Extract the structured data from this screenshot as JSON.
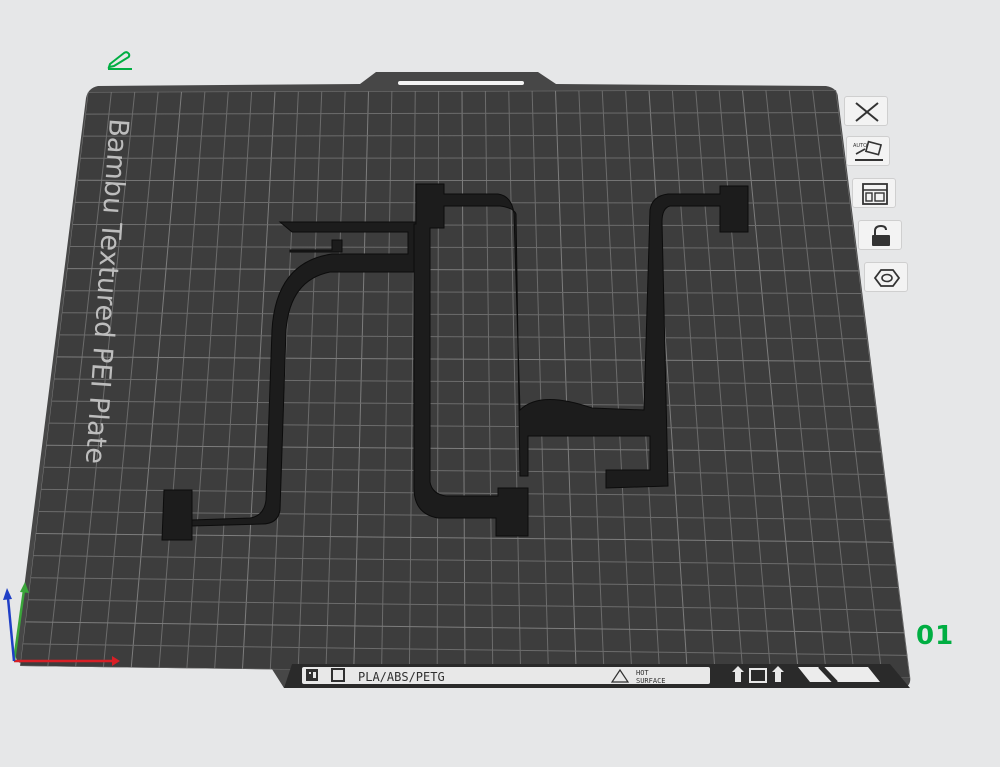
{
  "plate": {
    "name": "Bambu Textured PEI Plate",
    "material_label": "PLA/ABS/PETG",
    "hot_label_line1": "HOT",
    "hot_label_line2": "SURFACE",
    "number": "01"
  },
  "toolbar": {
    "icons": [
      "close-icon",
      "auto-orient-icon",
      "arrange-icon",
      "lock-icon",
      "plate-settings-icon"
    ],
    "auto_text": "AUTO"
  },
  "colors": {
    "accent": "#00ae42",
    "bed": "#3d3d3d",
    "grid": "#6c6c6c",
    "part": "#1d1d1d",
    "axis_x": "#d81f26",
    "axis_y": "#3aa53a",
    "axis_z": "#1f3fc6"
  }
}
